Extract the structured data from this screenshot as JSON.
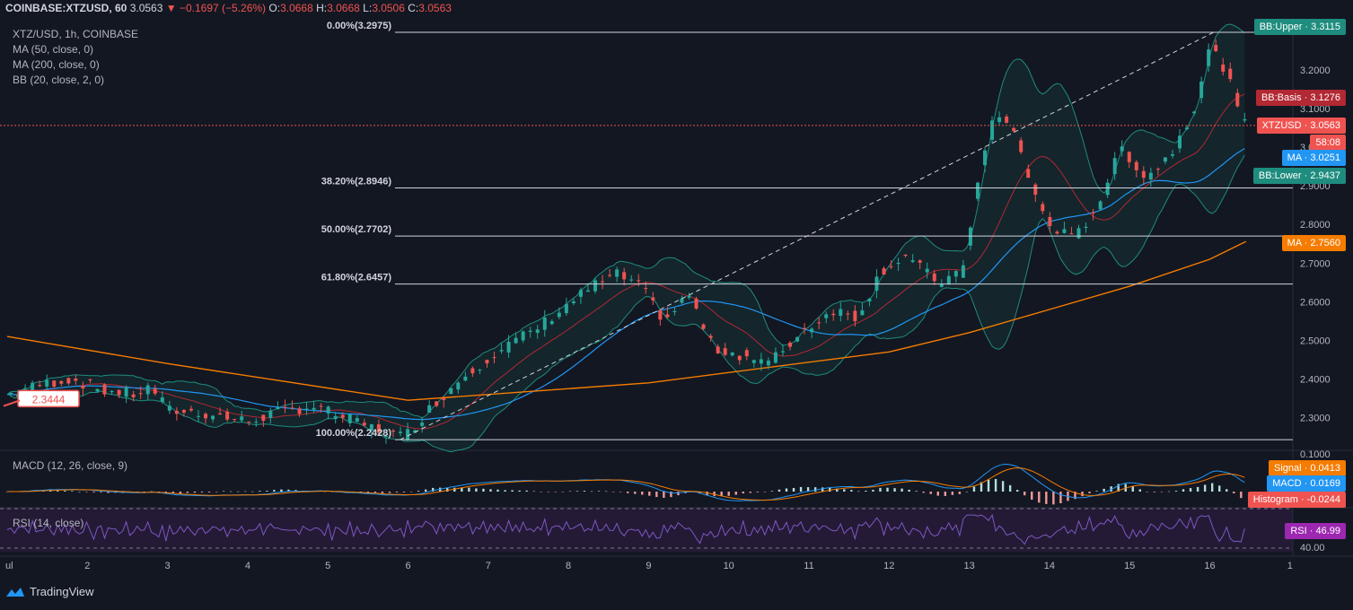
{
  "header": {
    "symbol": "COINBASE:XTZUSD, 60",
    "last": "3.0563",
    "change": "−0.1697 (−5.26%)",
    "o_label": "O:",
    "o": "3.0668",
    "h_label": "H:",
    "h": "3.0668",
    "l_label": "L:",
    "l": "3.0506",
    "c_label": "C:",
    "c": "3.0563"
  },
  "legend": {
    "pair": "XTZ/USD, 1h, COINBASE",
    "ma50": "MA (50, close, 0)",
    "ma200": "MA (200, close, 0)",
    "bb": "BB (20, close, 2, 0)"
  },
  "macd_label": "MACD (12, 26, close, 9)",
  "rsi_label": "RSI (14, close)",
  "callout": "2.3444",
  "tags": {
    "bb_upper": "BB:Upper · 3.3115",
    "bb_basis": "BB:Basis · 3.1276",
    "xtzusd": "XTZUSD · 3.0563",
    "countdown": "58:08",
    "ma_fast": "MA · 3.0251",
    "bb_lower": "BB:Lower · 2.9437",
    "ma_slow": "MA · 2.7560",
    "signal": "Signal · 0.0413",
    "macd": "MACD · 0.0169",
    "histogram": "Histogram · -0.0244",
    "rsi": "RSI · 46.99"
  },
  "branding": "TradingView",
  "colors": {
    "up": "#26a69a",
    "down": "#ef5350",
    "ma_fast": "#2196f3",
    "ma_slow": "#f57c00",
    "bb_basis": "#b22833",
    "bb_band": "#1e8c7e",
    "rsi": "#7e57c2"
  },
  "chart_data": {
    "type": "candlestick",
    "y_axis_ticks": [
      "3.2000",
      "3.1000",
      "3.0000",
      "2.9000",
      "2.8000",
      "2.7000",
      "2.6000",
      "2.5000",
      "2.4000",
      "2.3000"
    ],
    "x_axis_ticks": [
      "ul",
      "2",
      "3",
      "4",
      "5",
      "6",
      "7",
      "8",
      "9",
      "10",
      "11",
      "12",
      "13",
      "14",
      "15",
      "16",
      "1"
    ],
    "macd_axis_tick": "0.1000",
    "rsi_axis_tick": "40.00",
    "ylim": [
      2.22,
      3.33
    ],
    "fib_levels": [
      {
        "label": "0.00%(3.2975)",
        "value": 3.2975
      },
      {
        "label": "38.20%(2.8946)",
        "value": 2.8946
      },
      {
        "label": "50.00%(2.7702)",
        "value": 2.7702
      },
      {
        "label": "61.80%(2.6457)",
        "value": 2.6457
      },
      {
        "label": "100.00%(2.2428)",
        "value": 2.2428
      }
    ],
    "close_approx": [
      {
        "day": 1.0,
        "close": 2.36
      },
      {
        "day": 1.5,
        "close": 2.39
      },
      {
        "day": 1.8,
        "close": 2.4
      },
      {
        "day": 2.2,
        "close": 2.37
      },
      {
        "day": 2.6,
        "close": 2.36
      },
      {
        "day": 2.8,
        "close": 2.38
      },
      {
        "day": 3.0,
        "close": 2.32
      },
      {
        "day": 3.5,
        "close": 2.31
      },
      {
        "day": 4.0,
        "close": 2.29
      },
      {
        "day": 4.3,
        "close": 2.31
      },
      {
        "day": 4.8,
        "close": 2.33
      },
      {
        "day": 5.2,
        "close": 2.3
      },
      {
        "day": 5.6,
        "close": 2.27
      },
      {
        "day": 5.95,
        "close": 2.25
      },
      {
        "day": 6.3,
        "close": 2.33
      },
      {
        "day": 6.7,
        "close": 2.41
      },
      {
        "day": 7.1,
        "close": 2.47
      },
      {
        "day": 7.6,
        "close": 2.53
      },
      {
        "day": 7.9,
        "close": 2.58
      },
      {
        "day": 8.3,
        "close": 2.64
      },
      {
        "day": 8.6,
        "close": 2.67
      },
      {
        "day": 8.9,
        "close": 2.64
      },
      {
        "day": 9.2,
        "close": 2.55
      },
      {
        "day": 9.5,
        "close": 2.62
      },
      {
        "day": 9.8,
        "close": 2.48
      },
      {
        "day": 10.2,
        "close": 2.46
      },
      {
        "day": 10.5,
        "close": 2.44
      },
      {
        "day": 10.9,
        "close": 2.52
      },
      {
        "day": 11.3,
        "close": 2.58
      },
      {
        "day": 11.6,
        "close": 2.56
      },
      {
        "day": 11.9,
        "close": 2.68
      },
      {
        "day": 12.2,
        "close": 2.72
      },
      {
        "day": 12.6,
        "close": 2.65
      },
      {
        "day": 12.9,
        "close": 2.67
      },
      {
        "day": 13.1,
        "close": 2.9
      },
      {
        "day": 13.3,
        "close": 3.08
      },
      {
        "day": 13.55,
        "close": 3.05
      },
      {
        "day": 13.8,
        "close": 2.88
      },
      {
        "day": 14.0,
        "close": 2.8
      },
      {
        "day": 14.3,
        "close": 2.76
      },
      {
        "day": 14.6,
        "close": 2.85
      },
      {
        "day": 14.9,
        "close": 3.0
      },
      {
        "day": 15.2,
        "close": 2.92
      },
      {
        "day": 15.5,
        "close": 2.98
      },
      {
        "day": 15.8,
        "close": 3.1
      },
      {
        "day": 16.0,
        "close": 3.26
      },
      {
        "day": 16.2,
        "close": 3.2
      },
      {
        "day": 16.4,
        "close": 3.06
      }
    ]
  }
}
